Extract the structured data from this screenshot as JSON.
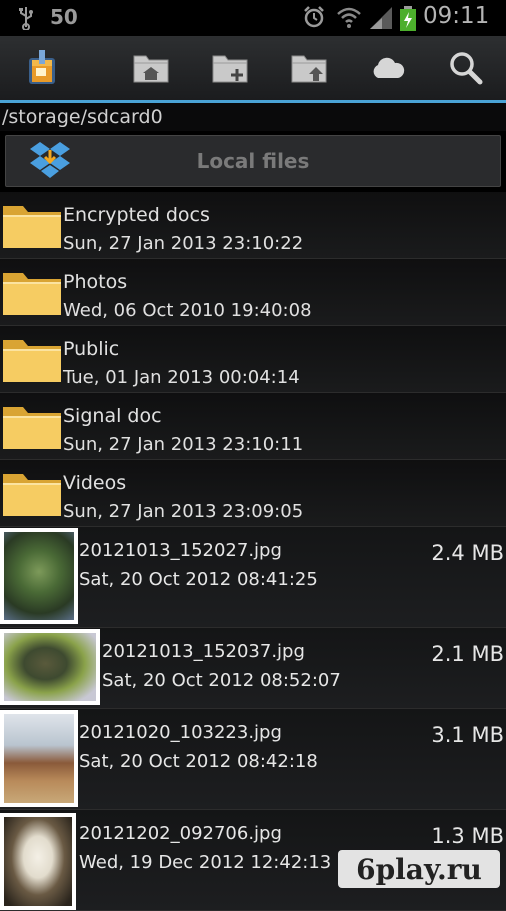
{
  "status_bar": {
    "notification_count": "50",
    "time": "09:11",
    "icons": [
      "usb-icon",
      "alarm-icon",
      "wifi-icon",
      "signal-icon",
      "battery-charging-icon"
    ]
  },
  "toolbar": {
    "buttons": [
      "app-logo-icon",
      "folder-home-icon",
      "new-folder-icon",
      "folder-up-icon",
      "cloud-icon",
      "search-icon"
    ],
    "accent_color": "#4aa3d6"
  },
  "path": "/storage/sdcard0",
  "local_files": {
    "label": "Local files",
    "icon": "dropbox-icon"
  },
  "folders": [
    {
      "name": "Encrypted docs",
      "date": "Sun, 27 Jan 2013 23:10:22"
    },
    {
      "name": "Photos",
      "date": "Wed, 06 Oct 2010 19:40:08"
    },
    {
      "name": "Public",
      "date": "Tue, 01 Jan 2013 00:04:14"
    },
    {
      "name": "Signal doc",
      "date": "Sun, 27 Jan 2013 23:10:11"
    },
    {
      "name": "Videos",
      "date": "Sun, 27 Jan 2013 23:09:05"
    }
  ],
  "files": [
    {
      "name": "20121013_152027.jpg",
      "date": "Sat, 20 Oct 2012 08:41:25",
      "size": "2.4 MB"
    },
    {
      "name": "20121013_152037.jpg",
      "date": "Sat, 20 Oct 2012 08:52:07",
      "size": "2.1 MB"
    },
    {
      "name": "20121020_103223.jpg",
      "date": "Sat, 20 Oct 2012 08:42:18",
      "size": "3.1 MB"
    },
    {
      "name": "20121202_092706.jpg",
      "date": "Wed, 19 Dec 2012 12:42:13",
      "size": "1.3 MB"
    }
  ],
  "watermark": "6play.ru"
}
